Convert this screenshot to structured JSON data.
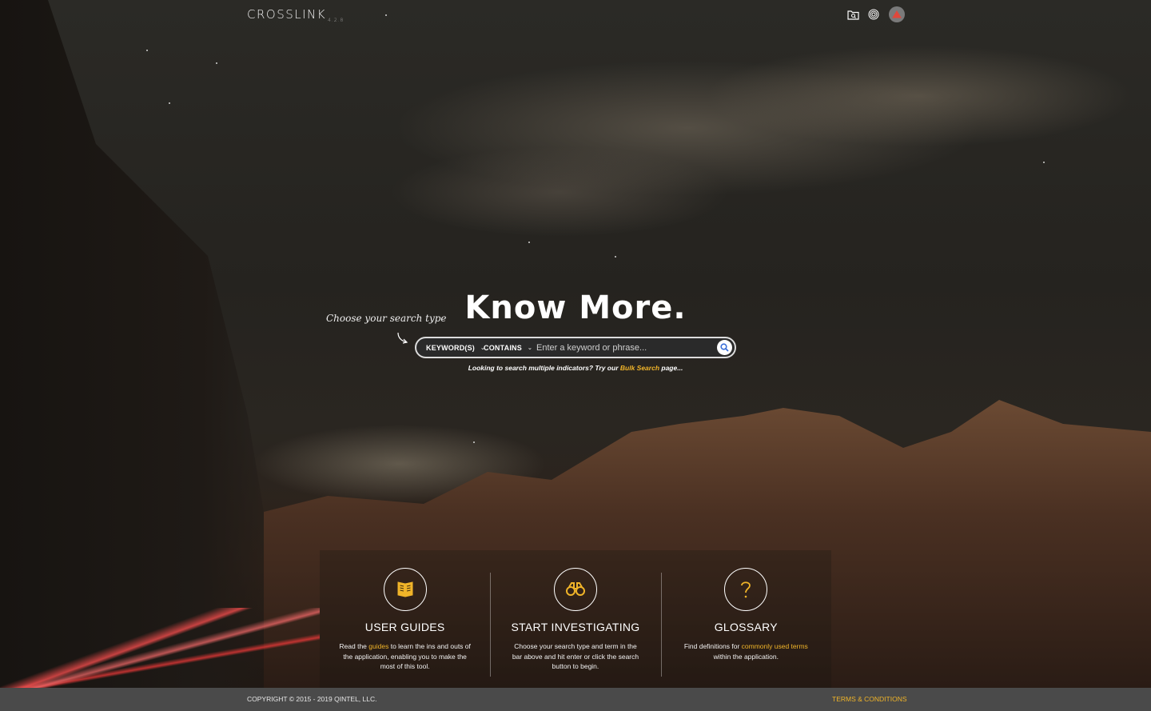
{
  "header": {
    "logo_text": "CROSSLINK",
    "version": "4.2.8",
    "icons": [
      "folder-search-icon",
      "fingerprint-icon",
      "user-avatar-icon"
    ]
  },
  "hero": {
    "title": "Know More.",
    "hint": "Choose your search type"
  },
  "search": {
    "type_selected": "KEYWORD(S)",
    "operator_selected": "CONTAINS",
    "placeholder": "Enter a keyword or phrase...",
    "bulk_prefix": "Looking to search multiple indicators? Try our ",
    "bulk_link": "Bulk Search",
    "bulk_suffix": " page..."
  },
  "features": [
    {
      "icon": "book-icon",
      "title": "USER GUIDES",
      "desc_a": "Read the ",
      "desc_link": "guides",
      "desc_b": " to learn the ins and outs of the application, enabling you to make the most of this tool."
    },
    {
      "icon": "binoculars-icon",
      "title": "START INVESTIGATING",
      "desc": "Choose your search type and term in the bar above and hit enter or click the search button to begin."
    },
    {
      "icon": "question-icon",
      "title": "GLOSSARY",
      "desc_a": "Find definitions for ",
      "desc_link": "commonly used terms",
      "desc_b": " within the application."
    }
  ],
  "footer": {
    "copyright": "COPYRIGHT © 2015 - 2019 QINTEL, LLC.",
    "terms": "TERMS & CONDITIONS"
  },
  "colors": {
    "accent": "#f0b429",
    "footer_bg": "#4a4a4a",
    "search_btn_icon": "#3a6fd8",
    "avatar_icon": "#e0483c"
  }
}
